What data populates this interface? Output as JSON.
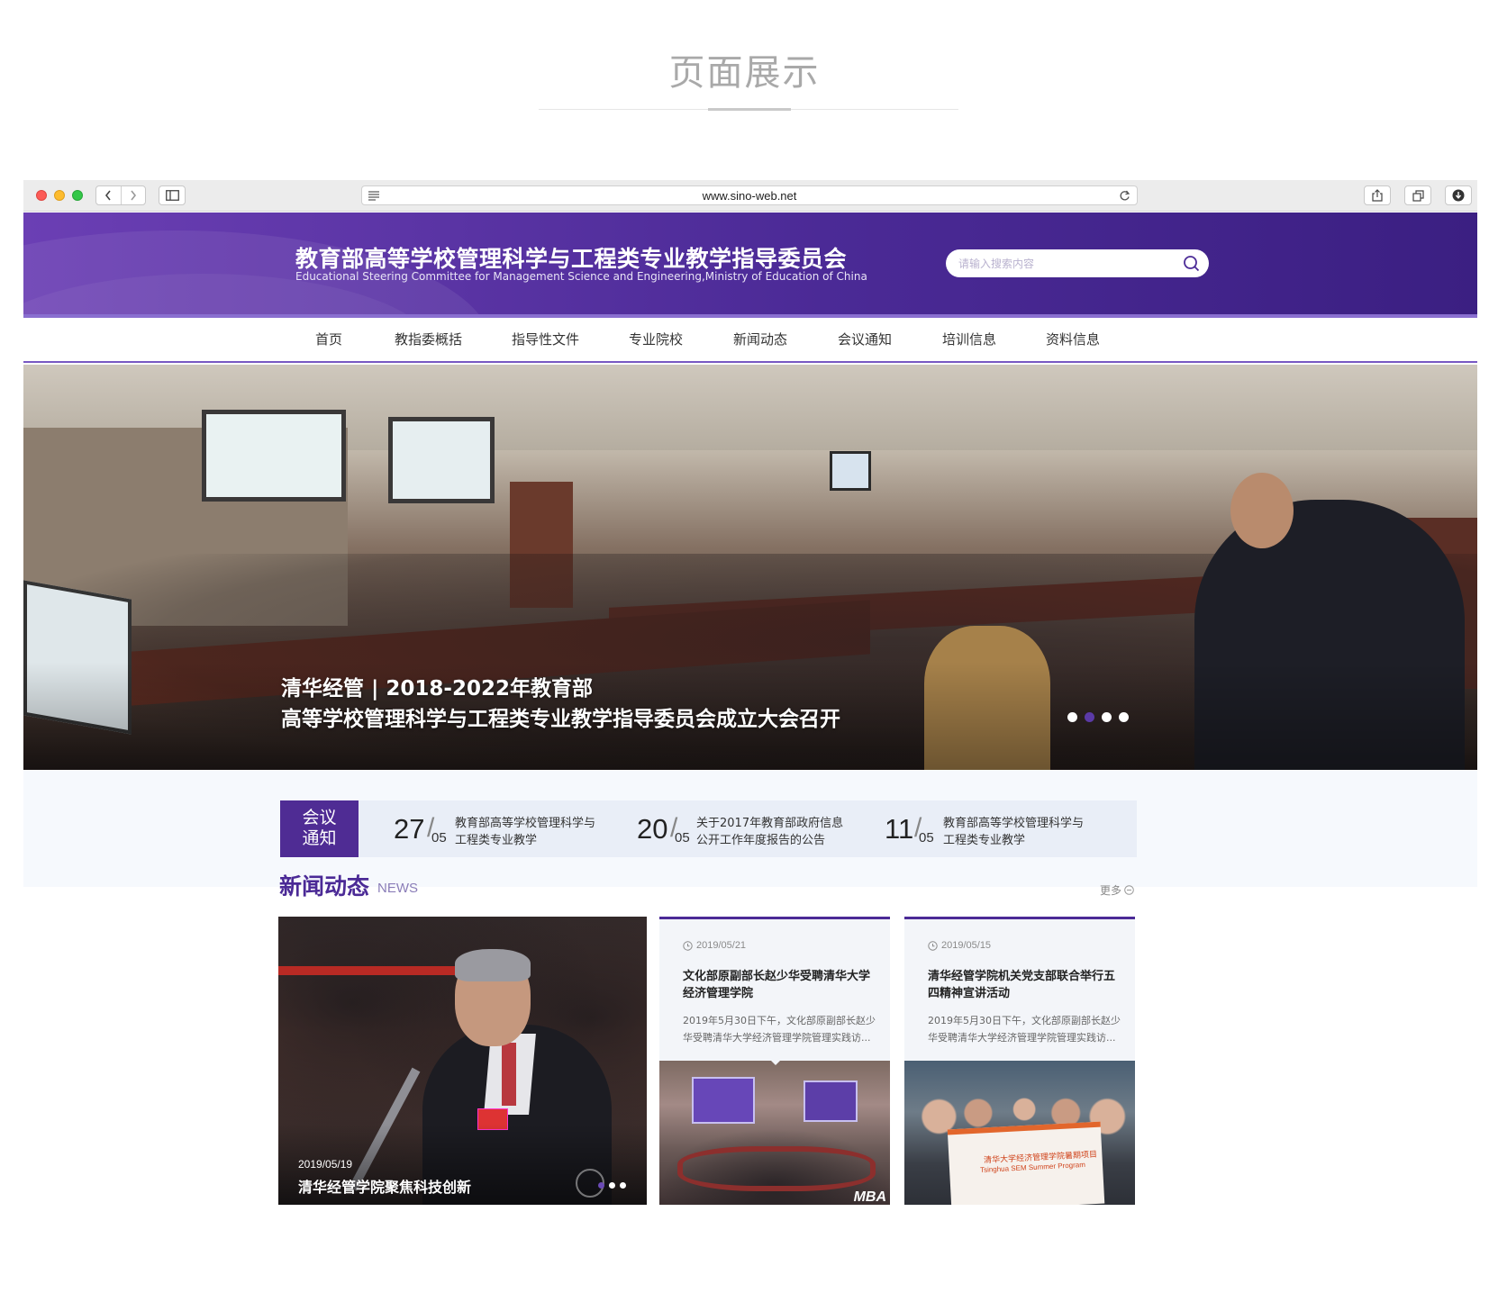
{
  "showcase": {
    "title": "页面展示"
  },
  "browser": {
    "url": "www.sino-web.net"
  },
  "site": {
    "title": "教育部高等学校管理科学与工程类专业教学指导委员会",
    "subtitle": "Educational Steering Committee for Management Science and Engineering,Ministry of Education of China",
    "search_placeholder": "请输入搜索内容"
  },
  "nav": {
    "items": [
      {
        "label": "首页"
      },
      {
        "label": "教指委概括"
      },
      {
        "label": "指导性文件"
      },
      {
        "label": "专业院校"
      },
      {
        "label": "新闻动态"
      },
      {
        "label": "会议通知"
      },
      {
        "label": "培训信息"
      },
      {
        "label": "资料信息"
      }
    ]
  },
  "hero": {
    "caption_line1": "清华经管 | 2018-2022年教育部",
    "caption_line2": "高等学校管理科学与工程类专业教学指导委员会成立大会召开",
    "slide_count": 4,
    "active_slide": 2
  },
  "notices": {
    "label_line1": "会议",
    "label_line2": "通知",
    "items": [
      {
        "day": "27",
        "month": "05",
        "line1": "教育部高等学校管理科学与",
        "line2": "工程类专业教学"
      },
      {
        "day": "20",
        "month": "05",
        "line1": "关于2017年教育部政府信息",
        "line2": "公开工作年度报告的公告"
      },
      {
        "day": "11",
        "month": "05",
        "line1": "教育部高等学校管理科学与",
        "line2": "工程类专业教学"
      }
    ]
  },
  "news": {
    "title": "新闻动态",
    "subtitle": "NEWS",
    "more_label": "更多",
    "feature": {
      "date": "2019/05/19",
      "title": "清华经管学院聚焦科技创新"
    },
    "cards": [
      {
        "date": "2019/05/21",
        "title_line1": "文化部原副部长赵少华受聘清华大学",
        "title_line2": "经济管理学院",
        "desc_line1": "2019年5月30日下午，文化部原副部长赵少",
        "desc_line2": "华受聘清华大学经济管理学院管理实践访...",
        "image_text": "MBA"
      },
      {
        "date": "2019/05/15",
        "title_line1": "清华经管学院机关党支部联合举行五",
        "title_line2": "四精神宣讲活动",
        "desc_line1": "2019年5月30日下午，文化部原副部长赵少",
        "desc_line2": "华受聘清华大学经济管理学院管理实践访...",
        "banner_text1": "清华大学经济管理学院暑期项目",
        "banner_text2": "Tsinghua SEM Summer Program"
      }
    ]
  },
  "colors": {
    "brand_purple": "#4b2a96",
    "header_gradient_start": "#6b3fb4",
    "notice_bg": "#e9eef7"
  }
}
